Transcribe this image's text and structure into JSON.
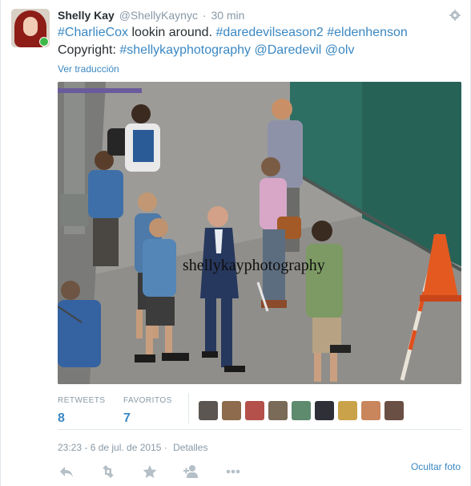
{
  "tweet": {
    "fullname": "Shelly Kay",
    "username": "@ShellyKaynyc",
    "separator": "·",
    "time": "30 min",
    "text": {
      "tag1": "#CharlieCox",
      "plain1": " lookin around. ",
      "tag2": "#daredevilseason2",
      "space1": " ",
      "tag3": "#eldenhenson",
      "plain2": " Copyright: ",
      "tag4": "#shellykayphotography",
      "space2": " ",
      "mention1": "@Daredevil",
      "space3": " ",
      "mention2": "@olv"
    },
    "translate_link": "Ver traducción",
    "photo_watermark": "shellykayphotography",
    "stats": {
      "retweets_label": "RETWEETS",
      "retweets_value": "8",
      "favorites_label": "FAVORITOS",
      "favorites_value": "7"
    },
    "favoriters_count": 9,
    "timestamp": "23:23 - 6 de jul. de 2015",
    "details_separator": "·",
    "details_link": "Detalles",
    "hide_photo": "Ocultar foto"
  },
  "icons": {
    "gear": "gear-icon",
    "reply": "reply-icon",
    "retweet": "retweet-icon",
    "favorite": "star-icon",
    "follow": "add-user-icon",
    "more": "more-dots-icon"
  },
  "colors": {
    "link": "#3b88c3",
    "muted": "#8899a6",
    "text": "#292f33",
    "border": "#e1e8ed"
  }
}
